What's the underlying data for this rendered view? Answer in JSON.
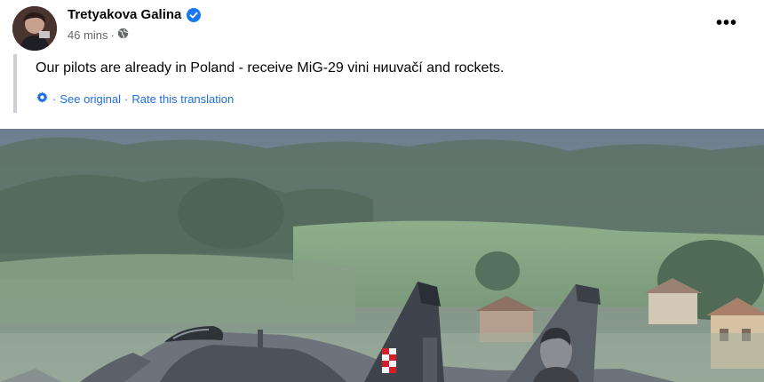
{
  "post": {
    "author": "Tretyakova Galina",
    "timestamp": "46 mins",
    "meta_separator": "·",
    "text": "Our pilots are already in Poland - receive MiG-29 vini ниuvačí and rockets.",
    "translation": {
      "see_original": "See original",
      "rate": "Rate this translation",
      "separator": "·"
    },
    "more_label": "•••"
  },
  "colors": {
    "verified": "#1877f2",
    "link": "#216fdb",
    "secondary_text": "#65676b",
    "quote_bar": "#ccd0d5"
  },
  "icons": [
    "verified-badge-icon",
    "globe-icon",
    "translate-gear-icon",
    "more-options-icon"
  ]
}
